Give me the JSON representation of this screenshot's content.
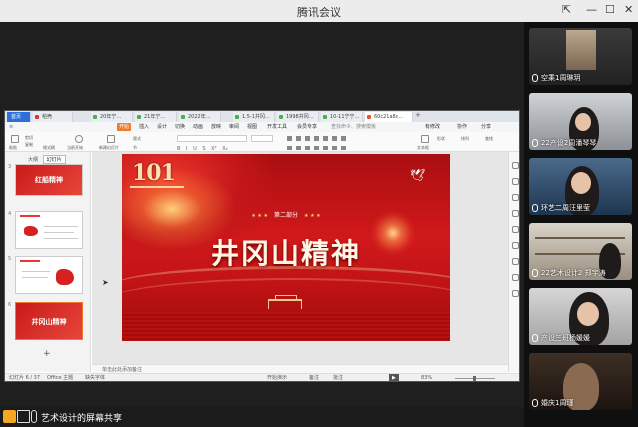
{
  "window": {
    "title": "腾讯会议",
    "min": "—",
    "max": "☐",
    "close": "✕"
  },
  "ppt": {
    "tabs": [
      "首页",
      "稻壳",
      "20年宁...",
      "21年宁...",
      "2022年...",
      "1.5-1井冈...",
      "1998井冈...",
      "10-11宁宁...",
      "60c21a8c..."
    ],
    "add_tab": "+",
    "menus": [
      "开始",
      "插入",
      "设计",
      "切换",
      "动画",
      "放映",
      "审阅",
      "视图",
      "开发工具",
      "会员专享"
    ],
    "search": "查找命令、搜索模板",
    "top_right": [
      "有修改",
      "协作",
      "分享"
    ],
    "ribbon_left": [
      "粘贴",
      "剪切",
      "复制",
      "格式刷",
      "当前开始",
      "新建幻灯片",
      "版式",
      "节"
    ],
    "ribbon_right": [
      "文本框",
      "形状",
      "排列",
      "查找"
    ],
    "font_tools": [
      "B",
      "I",
      "U",
      "S",
      "X²",
      "X₂"
    ],
    "panel_tabs": [
      "大纲",
      "幻灯片"
    ],
    "thumbs": [
      {
        "num": "3",
        "title": "红船精神"
      },
      {
        "num": "4",
        "title": ""
      },
      {
        "num": "5",
        "title": ""
      },
      {
        "num": "6",
        "title": "井冈山精神"
      }
    ],
    "add_slide": "+",
    "notes": "单击此处添加备注",
    "status": {
      "slide": "幻灯片 6 / 37",
      "theme": "Office 主题",
      "font": "缺失字体",
      "note_toggle": "开始演示",
      "notes_btn": "备注",
      "comment_btn": "批注",
      "zoom": "83%"
    }
  },
  "slide": {
    "logo": "101",
    "part": "第二部分",
    "stars": "★ ★ ★",
    "title": "井冈山精神"
  },
  "meeting": {
    "share_label": "艺术设计的屏幕共享",
    "participants": [
      {
        "name": "空乘1周琳玥"
      },
      {
        "name": "22产设2周潘琴琴"
      },
      {
        "name": "环艺二周汪里莹"
      },
      {
        "name": "22艺术设计2 郑宇涛"
      },
      {
        "name": "产设三班杨媛媛"
      },
      {
        "name": "婚庆1周瑾"
      }
    ]
  }
}
